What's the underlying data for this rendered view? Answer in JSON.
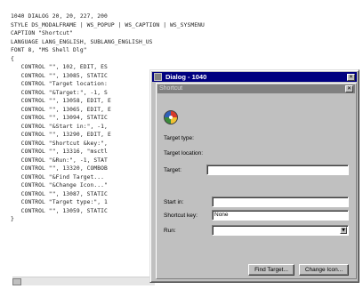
{
  "editor": {
    "code_lines": [
      "1040 DIALOG 20, 20, 227, 200",
      "STYLE DS_MODALFRAME | WS_POPUP | WS_CAPTION | WS_SYSMENU",
      "CAPTION \"Shortcut\"",
      "LANGUAGE LANG_ENGLISH, SUBLANG_ENGLISH_US",
      "FONT 8, \"MS Shell Dlg\"",
      "{",
      "   CONTROL \"\", 102, EDIT, ES",
      "   CONTROL \"\", 13085, STATIC",
      "   CONTROL \"Target location:",
      "   CONTROL \"&Target:\", -1, S",
      "   CONTROL \"\", 13058, EDIT, E",
      "   CONTROL \"\", 13065, EDIT, E",
      "   CONTROL \"\", 13094, STATIC",
      "   CONTROL \"&Start in:\", -1,",
      "   CONTROL \"\", 13290, EDIT, E",
      "   CONTROL \"Shortcut &key:\",",
      "   CONTROL \"\", 13316, \"msctl",
      "   CONTROL \"&Run:\", -1, STAT",
      "   CONTROL \"\", 13320, COMBOB",
      "   CONTROL \"&Find Target...",
      "   CONTROL \"&Change Icon...\"",
      "   CONTROL \"\", 13087, STATIC",
      "   CONTROL \"Target type:\", 1",
      "   CONTROL \"\", 13059, STATIC",
      "}"
    ]
  },
  "outer_dialog": {
    "title": "Dialog - 1040",
    "close_glyph": "✕"
  },
  "shortcut_dialog": {
    "title": "Shortcut",
    "close_glyph": "✕",
    "target_type_label": "Target type:",
    "target_location_label": "Target location:",
    "target_label": "Target:",
    "target_value": "",
    "start_in_label": "Start in:",
    "start_in_value": "",
    "shortcut_key_label": "Shortcut key:",
    "shortcut_key_value": "None",
    "run_label": "Run:",
    "run_value": "",
    "combo_arrow": "▼",
    "find_target_button": "Find Target...",
    "change_icon_button": "Change Icon..."
  }
}
